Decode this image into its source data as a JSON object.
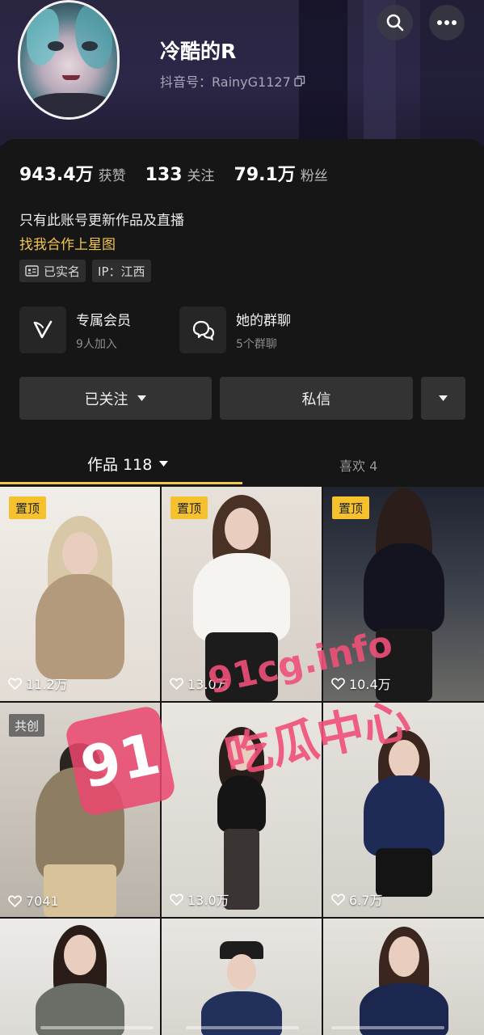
{
  "profile": {
    "name": "冷酷的R",
    "douyin_id_label": "抖音号：RainyG1127"
  },
  "stats": [
    {
      "value": "943.4万",
      "label": "获赞"
    },
    {
      "value": "133",
      "label": "关注"
    },
    {
      "value": "79.1万",
      "label": "粉丝"
    }
  ],
  "bio": {
    "line1": "只有此账号更新作品及直播",
    "link": "找我合作上星图"
  },
  "tags": {
    "verified": "已实名",
    "ip": "IP：江西"
  },
  "features": [
    {
      "title": "专属会员",
      "subtitle": "9人加入",
      "icon": "vip-v-icon"
    },
    {
      "title": "她的群聊",
      "subtitle": "5个群聊",
      "icon": "group-chat-icon"
    }
  ],
  "actions": {
    "follow": "已关注",
    "message": "私信"
  },
  "tabs": {
    "works": "作品 118",
    "likes": "喜欢 4"
  },
  "videos": [
    {
      "badge": "置顶",
      "likes": "11.2万"
    },
    {
      "badge": "置顶",
      "likes": "13.0万"
    },
    {
      "badge": "置顶",
      "likes": "10.4万"
    },
    {
      "badge": "共创",
      "likes": "7041"
    },
    {
      "badge": "",
      "likes": "13.0万"
    },
    {
      "badge": "",
      "likes": "6.7万"
    },
    {
      "badge": "",
      "likes": ""
    },
    {
      "badge": "",
      "likes": ""
    },
    {
      "badge": "",
      "likes": ""
    }
  ],
  "watermark": {
    "logo": "91",
    "url": "91cg.info",
    "text": "吃瓜中心"
  },
  "colors": {
    "accent": "#f2c54b",
    "pin_badge": "#f5c22d",
    "background": "#161616",
    "button": "#333333"
  }
}
